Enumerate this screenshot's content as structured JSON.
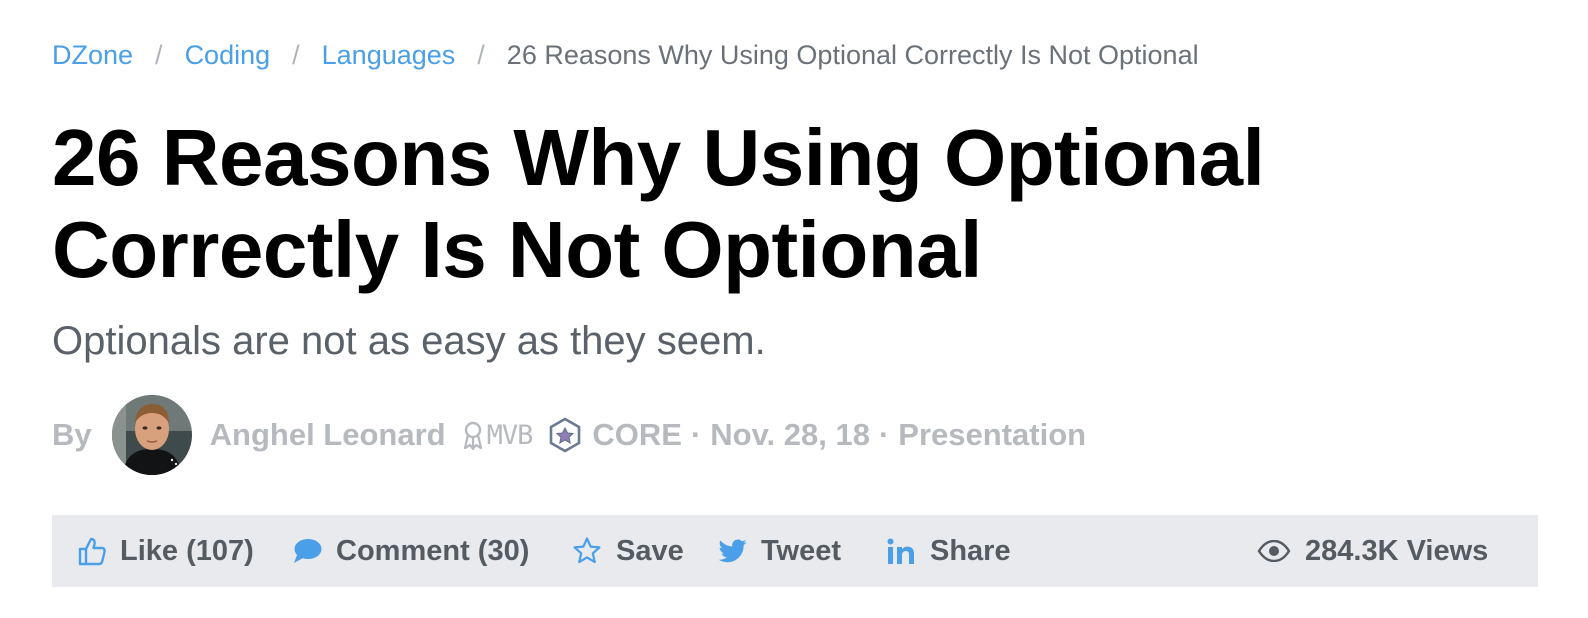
{
  "breadcrumb": {
    "items": [
      "DZone",
      "Coding",
      "Languages"
    ],
    "separator": "/",
    "current": "26 Reasons Why Using Optional Correctly Is Not Optional"
  },
  "article": {
    "title": "26 Reasons Why Using Optional Correctly Is Not Optional",
    "subtitle": "Optionals are not as easy as they seem."
  },
  "byline": {
    "by": "By",
    "author": "Anghel Leonard",
    "badge": "MVB",
    "zone": "CORE",
    "separator": "·",
    "date": "Nov. 28, 18",
    "category": "Presentation"
  },
  "actions": {
    "like": "Like (107)",
    "comment": "Comment (30)",
    "save": "Save",
    "tweet": "Tweet",
    "share": "Share",
    "views": "284.3K Views"
  },
  "colors": {
    "link": "#4a9fe8",
    "icon_blue": "#4a9fe8",
    "muted_text": "#b6babf",
    "action_bar_bg": "#e8eaed",
    "action_text": "#555b62"
  },
  "icons": {
    "like": "thumbs-up-icon",
    "comment": "speech-bubble-icon",
    "save": "star-icon",
    "tweet": "twitter-bird-icon",
    "share": "linkedin-icon",
    "views": "eye-icon",
    "badge": "ribbon-award-icon",
    "zone": "core-hexagon-icon"
  }
}
